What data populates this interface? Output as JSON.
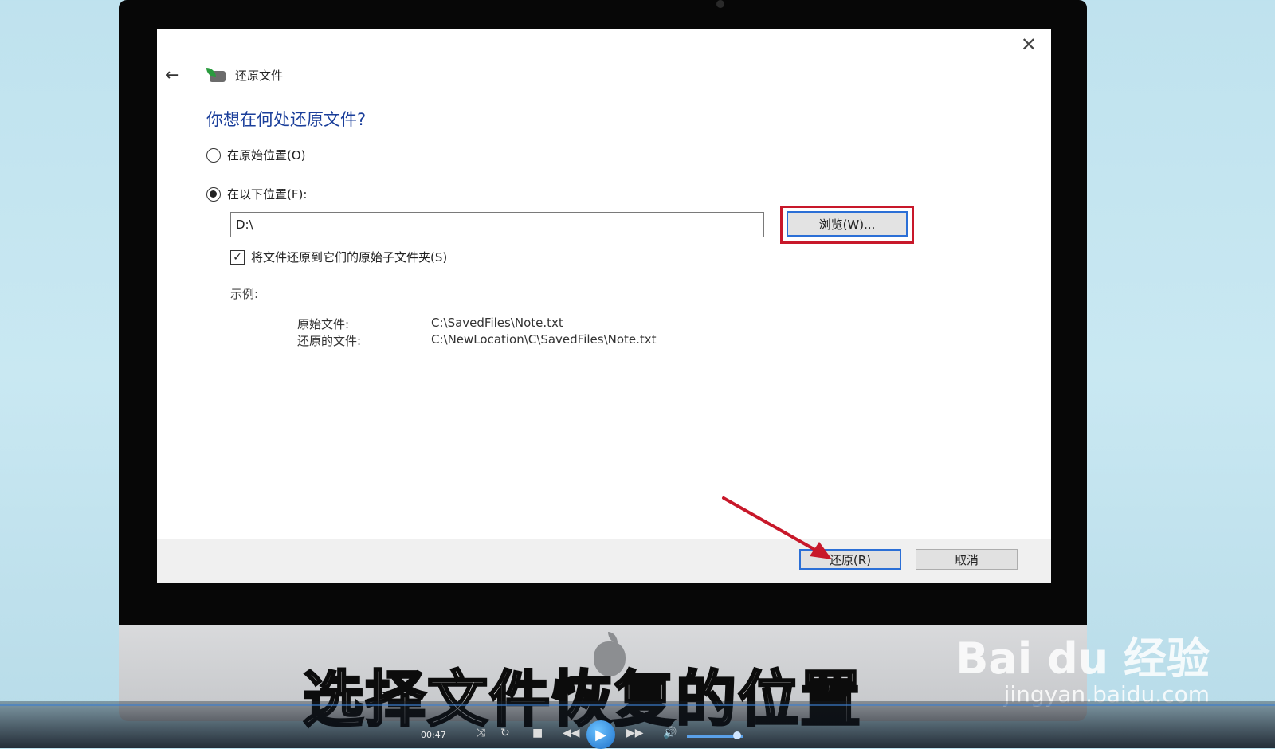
{
  "dialog": {
    "title": "还原文件",
    "heading": "你想在何处还原文件?",
    "option_original": "在原始位置(O)",
    "option_following": "在以下位置(F):",
    "path_value": "D:\\",
    "browse_label": "浏览(W)...",
    "checkbox_label": "将文件还原到它们的原始子文件夹(S)",
    "checkbox_checked": true,
    "selected_option": "following",
    "example_label": "示例:",
    "example": [
      {
        "label": "原始文件:",
        "value": "C:\\SavedFiles\\Note.txt"
      },
      {
        "label": "还原的文件:",
        "value": "C:\\NewLocation\\C\\SavedFiles\\Note.txt"
      }
    ],
    "restore_label": "还原(R)",
    "cancel_label": "取消"
  },
  "icons": {
    "back": "back-arrow-icon",
    "close": "close-icon",
    "app": "restore-files-icon"
  },
  "overlay": {
    "caption": "选择文件恢复的位置",
    "watermark_brand": "Bai du 经验",
    "watermark_site": "jingyan.baidu.com",
    "highlight_color": "#c8182a",
    "arrow_color": "#c8182a"
  },
  "player": {
    "time": "00:47"
  }
}
